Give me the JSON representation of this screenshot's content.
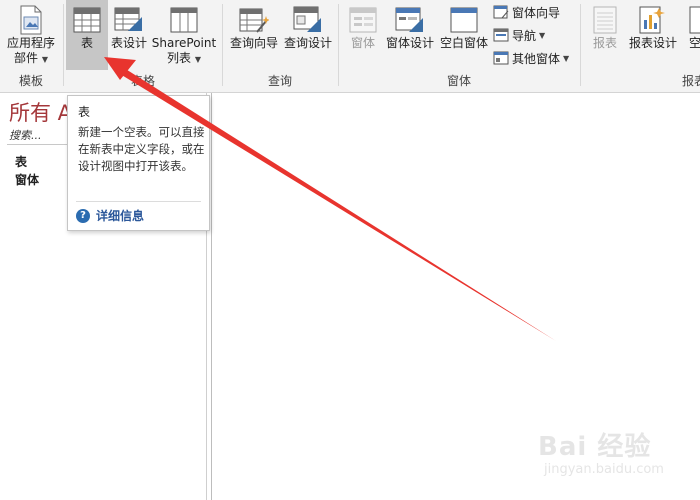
{
  "ribbon": {
    "groups": [
      {
        "label": "模板"
      },
      {
        "label": "表格"
      },
      {
        "label": "查询"
      },
      {
        "label": "窗体"
      },
      {
        "label": "报表"
      }
    ],
    "buttons": {
      "app_parts": {
        "label_line1": "应用程序",
        "label_line2": "部件"
      },
      "table": {
        "label": "表"
      },
      "table_design": {
        "label": "表设计"
      },
      "sharepoint": {
        "label_line1": "SharePoint",
        "label_line2": "列表"
      },
      "query_wizard": {
        "label": "查询向导"
      },
      "query_design": {
        "label": "查询设计"
      },
      "form": {
        "label": "窗体"
      },
      "form_design": {
        "label": "窗体设计"
      },
      "blank_form": {
        "label": "空白窗体"
      },
      "form_wizard": {
        "label": "窗体向导"
      },
      "navigation": {
        "label": "导航"
      },
      "more_forms": {
        "label": "其他窗体"
      },
      "report": {
        "label": "报表"
      },
      "report_design": {
        "label": "报表设计"
      },
      "blank_report": {
        "label": "空相"
      }
    }
  },
  "nav_pane": {
    "title": "所有 A",
    "search_placeholder": "搜索...",
    "categories": [
      "表",
      "窗体"
    ]
  },
  "tooltip": {
    "title": "表",
    "body": "新建一个空表。可以直接在新表中定义字段，或在设计视图中打开该表。",
    "more_info": "详细信息"
  },
  "watermark": {
    "main": "Bai 经验",
    "sub": "jingyan.baidu.com"
  },
  "colors": {
    "accent_title": "#a4373a",
    "arrow": "#e8342e",
    "link": "#2b579a"
  }
}
